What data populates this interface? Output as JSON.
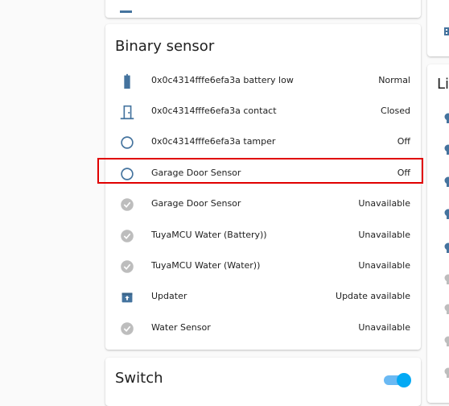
{
  "binary_sensor_card": {
    "title": "Binary sensor",
    "rows": [
      {
        "icon": "battery-icon",
        "name": "0x0c4314fffe6efa3a battery low",
        "state": "Normal"
      },
      {
        "icon": "door-icon",
        "name": "0x0c4314fffe6efa3a contact",
        "state": "Closed"
      },
      {
        "icon": "circle-outline-icon",
        "name": "0x0c4314fffe6efa3a tamper",
        "state": "Off"
      },
      {
        "icon": "circle-outline-icon",
        "name": "Garage Door Sensor",
        "state": "Off"
      },
      {
        "icon": "check-circle-icon",
        "name": "Garage Door Sensor",
        "state": "Unavailable"
      },
      {
        "icon": "check-circle-icon",
        "name": "TuyaMCU Water (Battery))",
        "state": "Unavailable"
      },
      {
        "icon": "check-circle-icon",
        "name": "TuyaMCU Water (Water))",
        "state": "Unavailable"
      },
      {
        "icon": "package-up-icon",
        "name": "Updater",
        "state": "Update available"
      },
      {
        "icon": "check-circle-icon",
        "name": "Water Sensor",
        "state": "Unavailable"
      }
    ]
  },
  "switch_card": {
    "title": "Switch",
    "toggle_on": true
  },
  "lights_card": {
    "title_partial": "Li"
  },
  "colors": {
    "icon_blue": "#44739e",
    "icon_grey": "#bdbdbd",
    "toggle_on": "#03a9f4",
    "highlight": "#e00000"
  }
}
